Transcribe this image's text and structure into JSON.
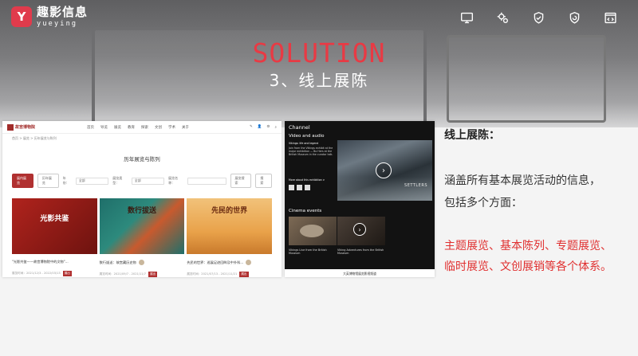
{
  "brand": {
    "name_cn": "趣影信息",
    "name_en": "yueying"
  },
  "header_icons": [
    "monitor-icon",
    "gears-icon",
    "shield-check-icon",
    "shield-refresh-icon",
    "code-icon"
  ],
  "title": {
    "en": "SOLUTION",
    "cn": "3、线上展陈"
  },
  "screenshot_museum": {
    "brand": "故宫博物院",
    "menu": [
      "首页",
      "导览",
      "展览",
      "教育",
      "探索",
      "文创",
      "学术",
      "关于"
    ],
    "breadcrumb": "首页 > 展览 > 历年展览与陈列",
    "heading": "历年展览与陈列",
    "tabs": [
      "展内展览",
      "历年展览"
    ],
    "filters": [
      "年份：",
      "全部",
      "展览类型：",
      "全部",
      "展览名称：",
      "展览搜索",
      "搜 索"
    ],
    "cards": [
      {
        "img_title": "光影共鉴",
        "caption": "\"光影共鉴——故宫博物院中的文物\"...",
        "meta": "展览时间：2021/12/3 - 2022/03/13",
        "badge": "展出"
      },
      {
        "img_title": "数行拔送",
        "caption": "数行拔送：故宫藏历史物",
        "meta": "展览时间：2021/09/7 - 2021/11/7",
        "badge": "展出"
      },
      {
        "img_title": "先民的世界",
        "caption": "先民的世界：巡展足迹回眸及中外科...",
        "meta": "展览时间：2021/07/13 - 2021/11/21",
        "badge": "展出"
      }
    ]
  },
  "screenshot_channel": {
    "channel": "Channel",
    "section": "Video and audio",
    "feature_title": "Vikings: life and legend",
    "feature_text": "Join from the Vikings exhibit at the major exhibition — Bo Hers at the British Museum in the curator talk.",
    "more": "More about this exhibition >",
    "cinema": "Cinema events",
    "items": [
      {
        "caption": "Vikings Live from the British Museum",
        "text": "Viking Live from the British Museum"
      },
      {
        "caption": "Viking Adventures from the British Museum",
        "text": "Viking Adventures from the British Museum"
      }
    ],
    "video_text": "SETTLERS",
    "footer": "大英博物馆展览影视频道"
  },
  "right_panel": {
    "title": "线上展陈：",
    "desc_line1": "涵盖所有基本展览活动的信息，",
    "desc_line2": "包括多个方面：",
    "list_line1": "主题展览、基本陈列、专题展览、",
    "list_line2": "临时展览、文创展销等各个体系。"
  },
  "colors": {
    "accent_red": "#e83a44",
    "museum_red": "#b03030",
    "list_red": "#e02f2f"
  }
}
